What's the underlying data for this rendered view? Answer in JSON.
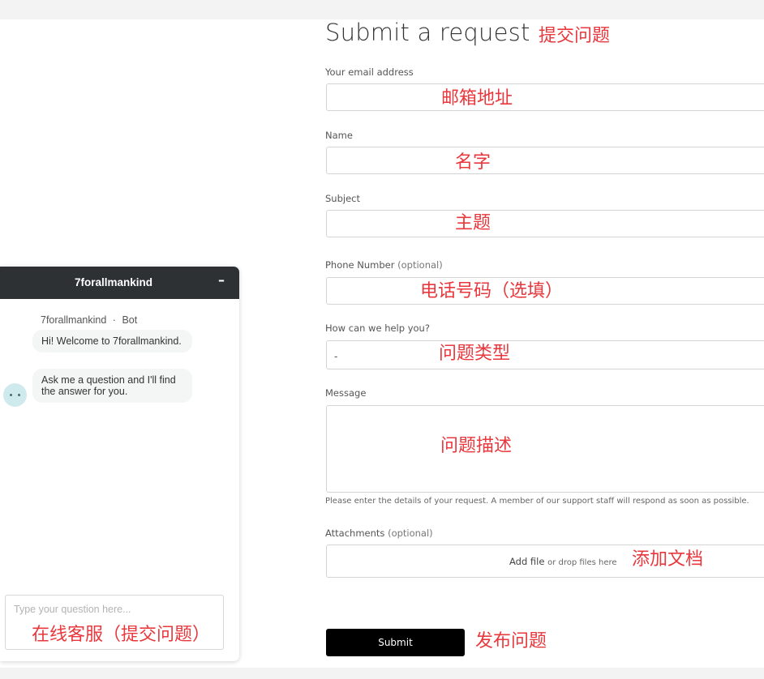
{
  "form": {
    "title": "Submit a request",
    "email_label": "Your email address",
    "name_label": "Name",
    "subject_label": "Subject",
    "phone_label": "Phone Number",
    "phone_optional": "(optional)",
    "help_label": "How can we help you?",
    "help_selected": "-",
    "message_label": "Message",
    "message_hint": "Please enter the details of your request. A member of our support staff will respond as soon as possible.",
    "attachments_label": "Attachments",
    "attachments_optional": "(optional)",
    "add_file": "Add file",
    "drop_files": "or drop files here",
    "submit_label": "Submit"
  },
  "chat": {
    "title": "7forallmankind",
    "minimize": "–",
    "bot_name": "7forallmankind",
    "separator": "·",
    "bot_role": "Bot",
    "messages": [
      "Hi! Welcome to 7forallmankind.",
      "Ask me a question and I'll find the answer for you."
    ],
    "input_placeholder": "Type your question here..."
  },
  "annotations": {
    "title": "提交问题",
    "email": "邮箱地址",
    "name": "名字",
    "subject": "主题",
    "phone": "电话号码（选填）",
    "help_type": "问题类型",
    "message": "问题描述",
    "attachment": "添加文档",
    "submit": "发布问题",
    "chat": "在线客服（提交问题）"
  },
  "colors": {
    "annotation": "#e8383d",
    "chat_header": "#2d3134",
    "submit_button": "#000000",
    "bot_avatar": "#cfeaec"
  }
}
